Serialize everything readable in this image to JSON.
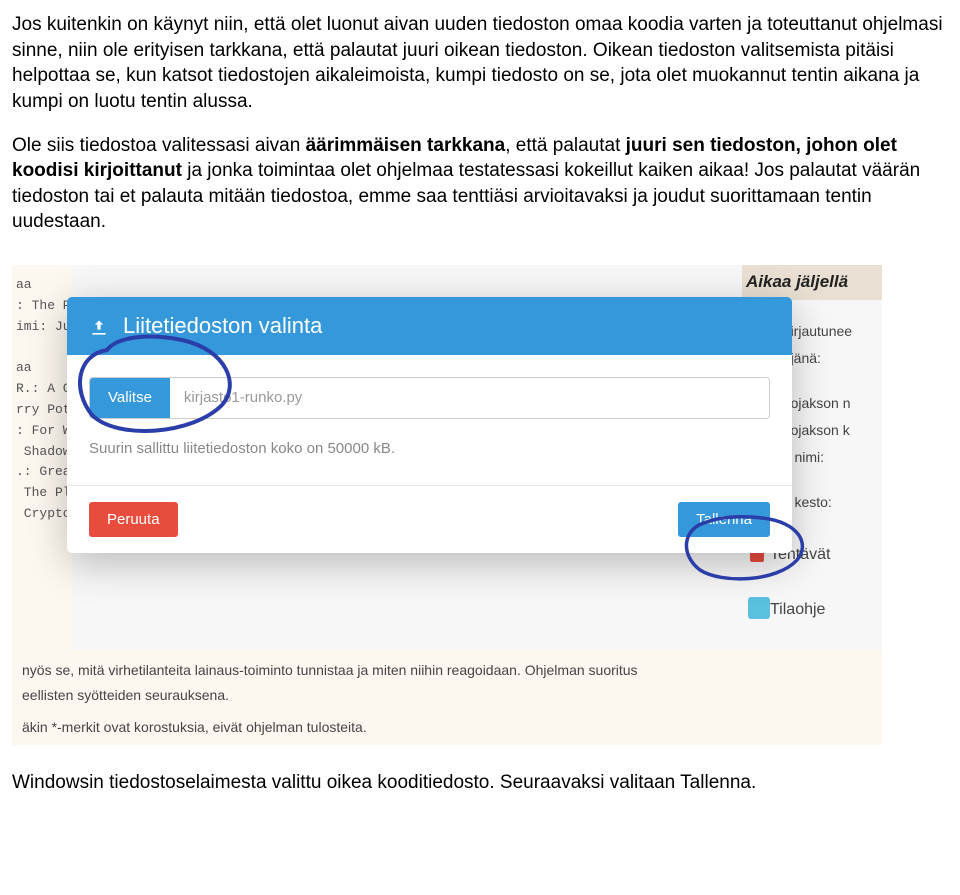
{
  "instructions": {
    "para1": "Jos kuitenkin on käynyt niin, että olet luonut aivan uuden tiedoston omaa koodia varten ja toteuttanut ohjelmasi sinne, niin ole erityisen tarkkana, että palautat juuri oikean tiedoston. Oikean tiedoston valitsemista pitäisi helpottaa se, kun katsot tiedostojen aikaleimoista, kumpi tiedosto on se, jota olet muokannut tentin aikana ja kumpi on luotu tentin alussa.",
    "para2_a": "Ole siis tiedostoa valitessasi aivan ",
    "para2_bold1": "äärimmäisen tarkkana",
    "para2_b": ", että palautat ",
    "para2_bold2": "juuri sen tiedoston, johon olet koodisi kirjoittanut",
    "para2_c": " ja jonka toimintaa olet ohjelmaa testatessasi kokeillut kaiken aikaa! Jos palautat väärän tiedoston tai et palauta mitään tiedostoa, emme saa tenttiäsi arvioitavaksi ja joudut suorittamaan tentin uudestaan."
  },
  "dialog": {
    "title": "Liitetiedoston valinta",
    "select_label": "Valitse",
    "filename": "kirjasto1-runko.py",
    "size_hint": "Suurin sallittu liitetiedoston koko on 50000 kB.",
    "cancel_label": "Peruuta",
    "save_label": "Tallenna"
  },
  "bg": {
    "left_text": "aa\n: The P\nimi: Ju\n\naa\nR.: A G\nrry Pot\n: For W\n Shadow\n.: Grea\n The Pl\n Crypto",
    "right_header": "Aikaa jäljellä",
    "right_line1": "et kirjautunee",
    "right_line2": "yttäjänä:",
    "right_line3": "pintojakson n",
    "right_line4": "pintojakson k",
    "right_line5": "ntin nimi:",
    "right_line6": "ntin kesto:",
    "right_big1": "Tehtävät",
    "right_big2": "Tilaohje",
    "bottom1": "nyös se, mitä virhetilanteita lainaus-toiminto tunnistaa ja miten niihin reagoidaan. Ohjelman suoritus",
    "bottom2": "eellisten syötteiden seurauksena.",
    "bottom3": "äkin *-merkit ovat korostuksia, eivät ohjelman tulosteita."
  },
  "caption": "Windowsin tiedostoselaimesta valittu oikea kooditiedosto. Seuraavaksi valitaan Tallenna."
}
